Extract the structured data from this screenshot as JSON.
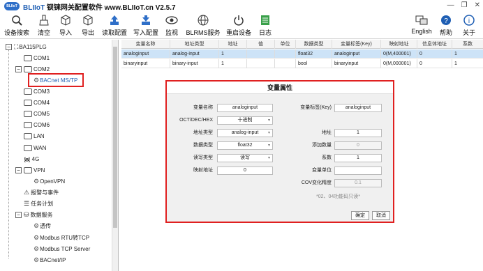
{
  "app": {
    "title_cn": "钡铼网关配置软件",
    "title_site": "www.BLIIoT.cn",
    "title_version": "V2.5.7",
    "brand": "BLIIoT",
    "logo_text": "BLIIoT"
  },
  "window": {
    "minimize": "—",
    "restore": "❐",
    "close": "✕"
  },
  "toolbar": {
    "search": "设备搜索",
    "clear": "清空",
    "import": "导入",
    "export": "导出",
    "read_config": "读取配置",
    "write_config": "写入配置",
    "monitor": "监视",
    "blrms": "BLRMS服务",
    "reboot": "重启设备",
    "log": "日志",
    "english": "English",
    "help": "帮助",
    "about": "关于"
  },
  "tree": {
    "root": "BA115PLG",
    "com1": "COM1",
    "com2": "COM2",
    "bacnet_mstp": "BACnet MS/TP",
    "com3": "COM3",
    "com4": "COM4",
    "com5": "COM5",
    "com6": "COM6",
    "lan": "LAN",
    "wan": "WAN",
    "g4": "4G",
    "vpn": "VPN",
    "openvpn": "OpenVPN",
    "alarm": "报警与事件",
    "task": "任务计划",
    "data_service": "数据服务",
    "transparent": "透传",
    "modbus_rtu_tcp": "Modbus RTU转TCP",
    "modbus_tcp_server": "Modbus TCP Server",
    "bacnet_ip": "BACnet/IP"
  },
  "grid": {
    "headers": [
      "变量名称",
      "地址类型",
      "地址",
      "值",
      "单位",
      "数据类型",
      "变量标签(Key)",
      "映射地址",
      "信息体地址",
      "系数"
    ],
    "rows": [
      [
        "analoginput",
        "analog-input",
        "1",
        "",
        "",
        "float32",
        "analoginput",
        "0(M,400001)",
        "0",
        "1"
      ],
      [
        "binaryinput",
        "binary-input",
        "1",
        "",
        "",
        "bool",
        "binaryinput",
        "0(M,000001)",
        "0",
        "1"
      ]
    ]
  },
  "dialog": {
    "title": "变量属性",
    "var_name_label": "变量名称",
    "var_name_value": "analoginput",
    "var_key_label": "变量标签(Key)",
    "var_key_value": "analoginput",
    "octdec_label": "OCT/DEC/HEX",
    "octdec_value": "十进制",
    "addr_type_label": "地址类型",
    "addr_type_value": "analog-input",
    "addr_label": "地址",
    "addr_value": "1",
    "data_type_label": "数据类型",
    "data_type_value": "float32",
    "add_count_label": "添加数量",
    "add_count_value": "0",
    "rw_label": "读写类型",
    "rw_value": "读写",
    "coef_label": "系数",
    "coef_value": "1",
    "map_addr_label": "映射地址",
    "map_addr_value": "0",
    "unit_label": "变量单位",
    "unit_value": "",
    "cov_label": "COV变化精度",
    "cov_value": "0.1",
    "note": "*02、04功能码只读*",
    "ok": "确定",
    "cancel": "取消"
  },
  "colors": {
    "accent": "#1f5fb4",
    "highlight": "#e02020",
    "selected_row": "#cde3f7"
  }
}
